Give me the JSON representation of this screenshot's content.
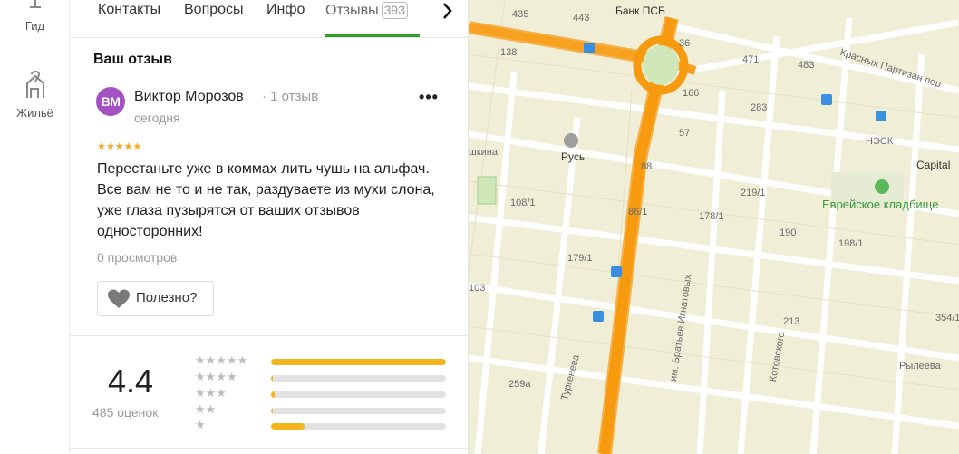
{
  "rail": {
    "items": [
      {
        "label": "Гид",
        "icon": "guide-icon"
      },
      {
        "label": "Жильё",
        "icon": "housing-icon"
      }
    ]
  },
  "tabs": {
    "items": [
      "Контакты",
      "Вопросы",
      "Инфо",
      "Отзывы"
    ],
    "reviews_count": "393",
    "next_icon": "chevron-right-icon"
  },
  "review": {
    "section_title": "Ваш отзыв",
    "avatar_initials": "ВМ",
    "author": "Виктор Морозов",
    "author_reviews": "· 1 отзыв",
    "date": "сегодня",
    "stars": "★★★★★",
    "rating": 5,
    "text": "Перестаньте уже в коммах лить чушь на альфач. Все вам не то и не так, раздуваете из мухи слона, уже глаза пузырятся от ваших отзывов односторонних!",
    "views": "0 просмотров",
    "useful_label": "Полезно?",
    "more_label": "•••"
  },
  "summary": {
    "rating": "4.4",
    "count": "485 оценок",
    "distribution": [
      {
        "stars": "★★★★★",
        "fraction": 1.0
      },
      {
        "stars": "★★★★",
        "fraction": 0.01
      },
      {
        "stars": "★★★",
        "fraction": 0.02
      },
      {
        "stars": "★★",
        "fraction": 0.01
      },
      {
        "stars": "★",
        "fraction": 0.19
      }
    ],
    "accent_color": "#f5b31c"
  },
  "map": {
    "labels": [
      {
        "text": "Банк ПСБ",
        "cls": "big"
      },
      {
        "text": "Красных Партизан пер",
        "cls": ""
      },
      {
        "text": "Русь",
        "cls": "big"
      },
      {
        "text": "НЭСК",
        "cls": ""
      },
      {
        "text": "Capital",
        "cls": "big"
      },
      {
        "text": "Еврейское кладбище",
        "cls": "green"
      },
      {
        "text": "Тургенева",
        "cls": ""
      },
      {
        "text": "им. Братьев Игнатовых",
        "cls": ""
      },
      {
        "text": "Котовского",
        "cls": ""
      },
      {
        "text": "Рылеева",
        "cls": ""
      },
      {
        "text": "шкина",
        "cls": ""
      },
      {
        "text": "435",
        "cls": ""
      },
      {
        "text": "443",
        "cls": ""
      },
      {
        "text": "138",
        "cls": ""
      },
      {
        "text": "36",
        "cls": ""
      },
      {
        "text": "471",
        "cls": ""
      },
      {
        "text": "483",
        "cls": ""
      },
      {
        "text": "166",
        "cls": ""
      },
      {
        "text": "283",
        "cls": ""
      },
      {
        "text": "57",
        "cls": ""
      },
      {
        "text": "88",
        "cls": ""
      },
      {
        "text": "219/1",
        "cls": ""
      },
      {
        "text": "108/1",
        "cls": ""
      },
      {
        "text": "86/1",
        "cls": ""
      },
      {
        "text": "178/1",
        "cls": ""
      },
      {
        "text": "190",
        "cls": ""
      },
      {
        "text": "198/1",
        "cls": ""
      },
      {
        "text": "179/1",
        "cls": ""
      },
      {
        "text": "103",
        "cls": ""
      },
      {
        "text": "213",
        "cls": ""
      },
      {
        "text": "259а",
        "cls": ""
      },
      {
        "text": "354/1",
        "cls": ""
      }
    ]
  }
}
